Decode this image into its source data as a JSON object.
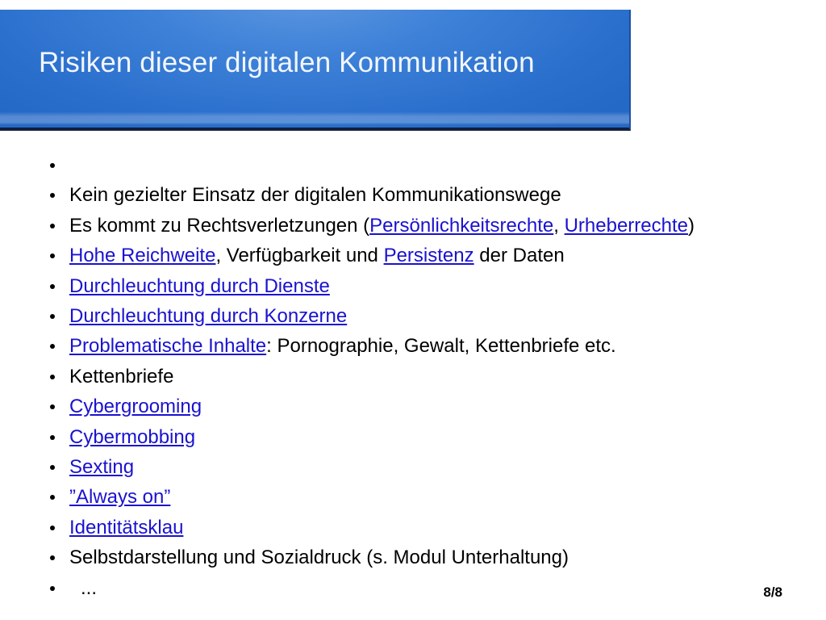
{
  "slide": {
    "title": "Risiken dieser digitalen Kommunikation",
    "page_number": "8/8",
    "colors": {
      "banner_blue": "#2b72d0",
      "banner_highlight": "#5e97e0",
      "banner_shadow": "#14213f",
      "link_blue": "#1a12cf",
      "text_black": "#000000",
      "title_text": "#f2f6fc",
      "background": "#ffffff"
    },
    "bullets": [
      {
        "id": "bullet-empty",
        "segments": []
      },
      {
        "id": "bullet-kein-gezielter-einsatz",
        "segments": [
          {
            "text": "Kein gezielter Einsatz der digitalen Kommunikationswege",
            "style": "plain"
          }
        ]
      },
      {
        "id": "bullet-rechtsverletzungen",
        "segments": [
          {
            "text": "Es kommt zu Rechtsverletzungen (",
            "style": "plain"
          },
          {
            "text": "Persönlichkeitsrechte",
            "style": "link"
          },
          {
            "text": ", ",
            "style": "plain"
          },
          {
            "text": "Urheberrechte",
            "style": "link"
          },
          {
            "text": ")",
            "style": "plain"
          }
        ]
      },
      {
        "id": "bullet-hohe-reichweite",
        "segments": [
          {
            "text": "Hohe Reichweite",
            "style": "link"
          },
          {
            "text": ", Verfügbarkeit und ",
            "style": "plain"
          },
          {
            "text": "Persistenz",
            "style": "link"
          },
          {
            "text": " der Daten",
            "style": "plain"
          }
        ]
      },
      {
        "id": "bullet-durchleuchtung-dienste",
        "segments": [
          {
            "text": "Durchleuchtung durch Dienste",
            "style": "link"
          }
        ]
      },
      {
        "id": "bullet-durchleuchtung-konzerne",
        "segments": [
          {
            "text": "Durchleuchtung durch Konzerne",
            "style": "link"
          }
        ]
      },
      {
        "id": "bullet-problematische-inhalte",
        "segments": [
          {
            "text": "Problematische Inhalte",
            "style": "link"
          },
          {
            "text": ": Pornographie, Gewalt, Kettenbriefe etc.",
            "style": "plain"
          }
        ]
      },
      {
        "id": "bullet-kettenbriefe",
        "segments": [
          {
            "text": "Kettenbriefe",
            "style": "plain"
          }
        ]
      },
      {
        "id": "bullet-cybergrooming",
        "segments": [
          {
            "text": "Cybergrooming",
            "style": "link"
          }
        ]
      },
      {
        "id": "bullet-cybermobbing",
        "segments": [
          {
            "text": "Cybermobbing",
            "style": "link"
          }
        ]
      },
      {
        "id": "bullet-sexting",
        "segments": [
          {
            "text": "Sexting",
            "style": "link"
          }
        ]
      },
      {
        "id": "bullet-always-on",
        "segments": [
          {
            "text": "”Always on”",
            "style": "link"
          }
        ]
      },
      {
        "id": "bullet-identitaetsklau",
        "segments": [
          {
            "text": "Identitätsklau",
            "style": "link"
          }
        ]
      },
      {
        "id": "bullet-selbstdarstellung",
        "segments": [
          {
            "text": "Selbstdarstellung und Sozialdruck (s. Modul Unterhaltung)",
            "style": "plain"
          }
        ]
      },
      {
        "id": "bullet-ellipsis",
        "indent": true,
        "segments": [
          {
            "text": "...",
            "style": "plain"
          }
        ]
      }
    ]
  }
}
